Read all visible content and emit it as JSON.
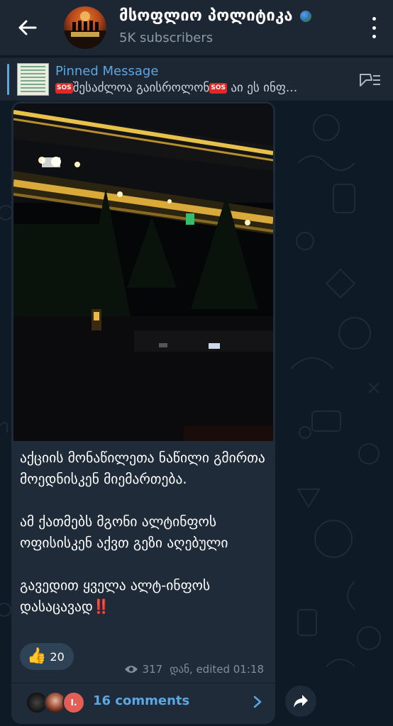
{
  "header": {
    "title": "მსოფლიო პოლიტიკა",
    "subscribers": "5K subscribers",
    "icons": [
      "back-arrow-icon",
      "globe-icon",
      "more-vertical-icon"
    ]
  },
  "pinned": {
    "label": "Pinned Message",
    "text_part1": "შესაძლოა გაისროლონ",
    "text_part2": " აი ეს ინფ...",
    "sos_badge": "SOS"
  },
  "message": {
    "paragraphs": [
      "აქციის მონაწილეთა ნაწილი გმირთა მოედნისკენ მიემართება.",
      "ამ ქათმებს მგონი ალტინფოს ოფისისკენ აქვთ გეზი აღებული",
      "გავედით ყველა ალტ-ინფოს დასაცავად"
    ],
    "exclamation": "‼️",
    "reaction": {
      "emoji": "👍",
      "count": "20"
    },
    "views": "317",
    "footer": "დან, edited 01:18",
    "comments_label": "16 comments",
    "commenter_initial": "I."
  },
  "colors": {
    "background": "#0f1a27",
    "header": "#1c2733",
    "bubble": "#1f2b38",
    "accent": "#5ba7e4",
    "muted": "#8b9aa8"
  }
}
